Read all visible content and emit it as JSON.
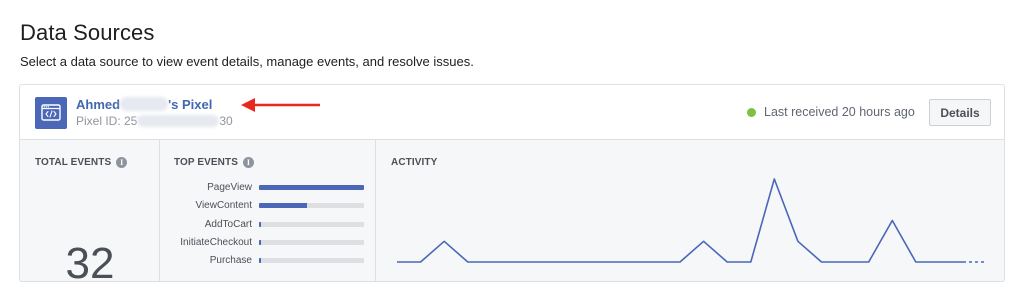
{
  "header": {
    "title": "Data Sources",
    "subtitle": "Select a data source to view event details, manage events, and resolve issues."
  },
  "pixel": {
    "icon": "pixel-code-icon",
    "name_prefix": "Ahmed",
    "name_suffix": "'s Pixel",
    "id_prefix": "Pixel ID: 25",
    "id_suffix": "30",
    "status": "Last received 20 hours ago",
    "status_color": "#7ac144",
    "details_label": "Details"
  },
  "annotation": {
    "arrow_color": "#e8291c"
  },
  "total_events": {
    "label": "TOTAL EVENTS",
    "value": "32"
  },
  "top_events": {
    "label": "TOP EVENTS",
    "items": [
      {
        "name": "PageView",
        "fraction": 1.0
      },
      {
        "name": "ViewContent",
        "fraction": 0.46
      },
      {
        "name": "AddToCart",
        "fraction": 0.02
      },
      {
        "name": "InitiateCheckout",
        "fraction": 0.02
      },
      {
        "name": "Purchase",
        "fraction": 0.02
      }
    ]
  },
  "activity": {
    "label": "ACTIVITY",
    "color": "#4a67b8",
    "values": [
      0,
      0,
      1,
      0,
      0,
      0,
      0,
      0,
      0,
      0,
      0,
      0,
      0,
      1,
      0,
      0,
      4,
      1,
      0,
      0,
      0,
      2,
      0,
      0,
      0
    ],
    "dashed_tail": 1
  }
}
